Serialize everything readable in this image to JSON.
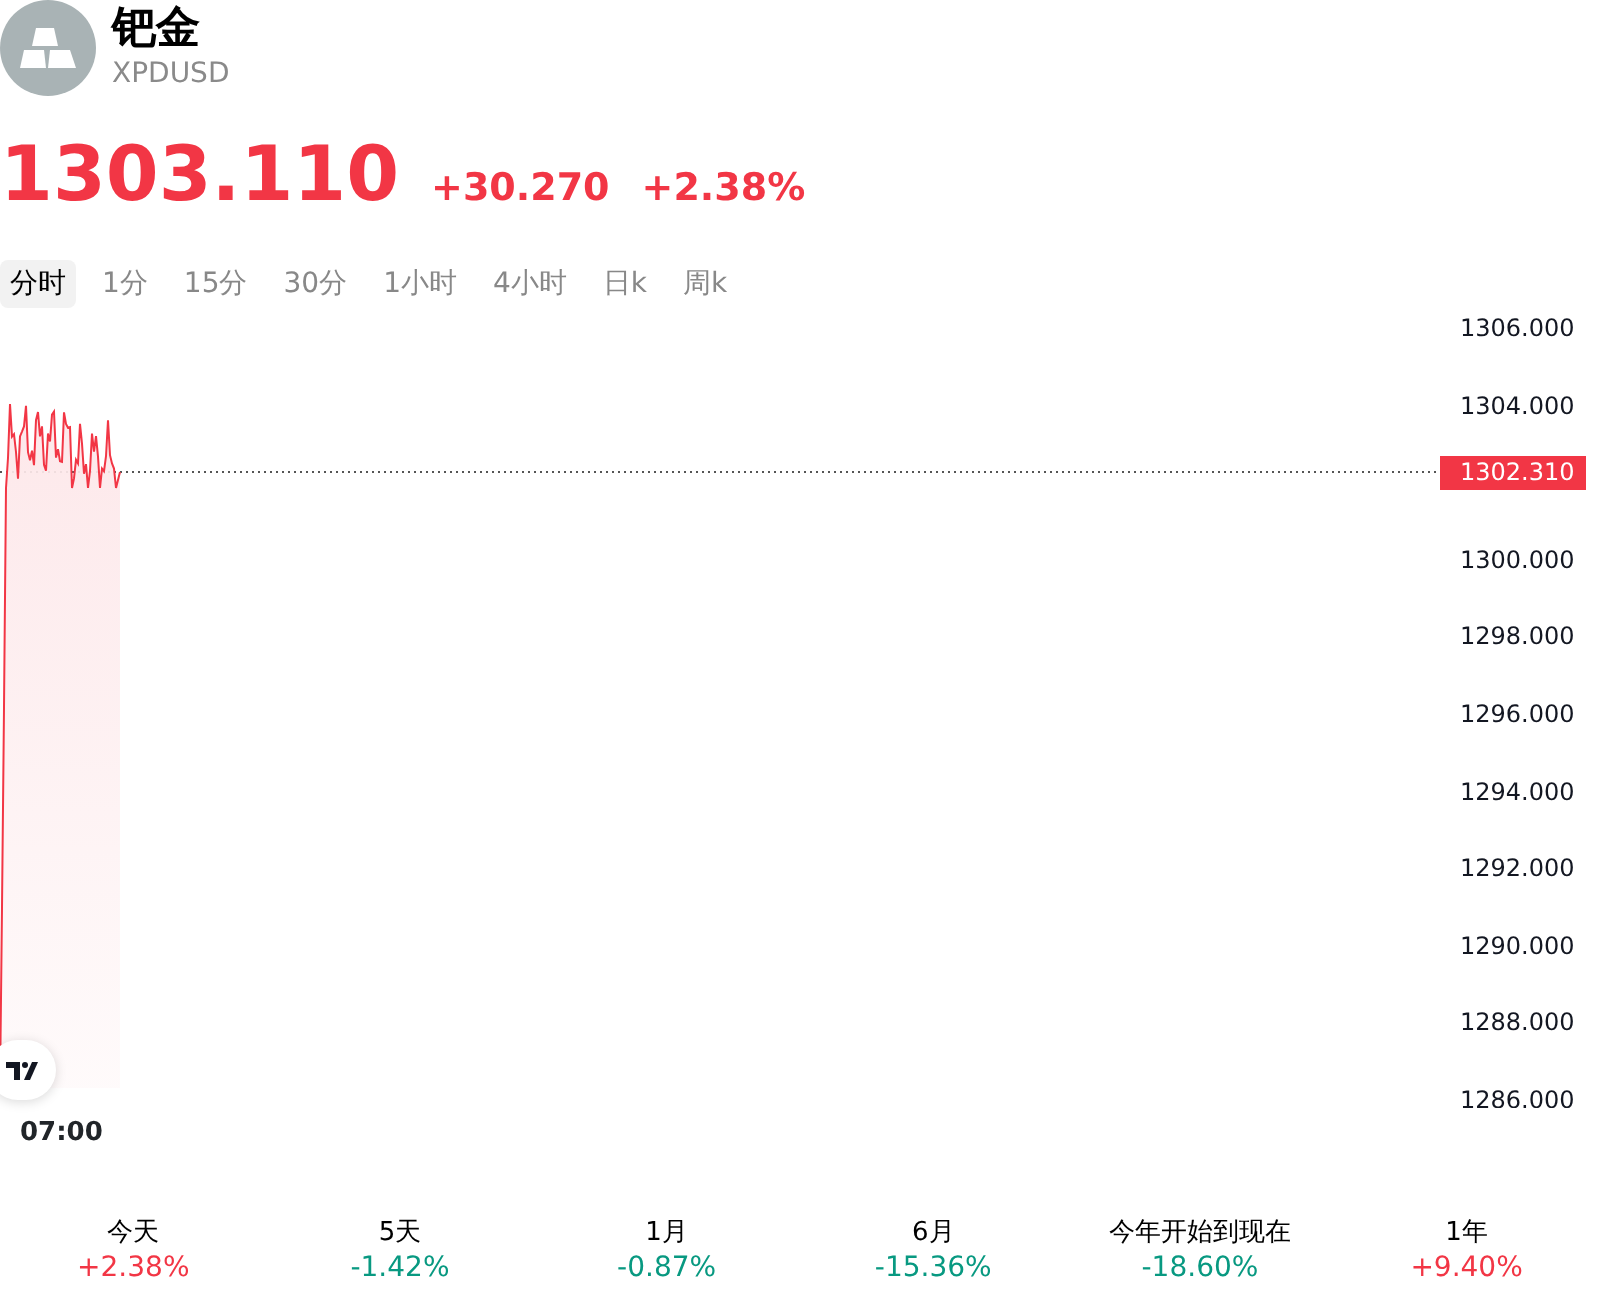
{
  "instrument": {
    "name": "钯金",
    "symbol": "XPDUSD"
  },
  "quote": {
    "price": "1303.110",
    "change": "+30.270",
    "change_percent": "+2.38%"
  },
  "intervals": [
    {
      "label": "分时",
      "selected": true
    },
    {
      "label": "1分",
      "selected": false
    },
    {
      "label": "15分",
      "selected": false
    },
    {
      "label": "30分",
      "selected": false
    },
    {
      "label": "1小时",
      "selected": false
    },
    {
      "label": "4小时",
      "selected": false
    },
    {
      "label": "日k",
      "selected": false
    },
    {
      "label": "周k",
      "selected": false
    }
  ],
  "chart": {
    "price_axis": [
      "1306.000",
      "1304.000",
      "1300.000",
      "1298.000",
      "1296.000",
      "1294.000",
      "1292.000",
      "1290.000",
      "1288.000",
      "1286.000"
    ],
    "current_price": "1302.310",
    "time_label": "07:00"
  },
  "periods": [
    {
      "label": "今天",
      "change": "+2.38%",
      "color": "#f23645"
    },
    {
      "label": "5天",
      "change": "-1.42%",
      "color": "#089981"
    },
    {
      "label": "1月",
      "change": "-0.87%",
      "color": "#089981"
    },
    {
      "label": "6月",
      "change": "-15.36%",
      "color": "#089981"
    },
    {
      "label": "今年开始到现在",
      "change": "-18.60%",
      "color": "#089981"
    },
    {
      "label": "1年",
      "change": "+9.40%",
      "color": "#f23645"
    }
  ]
}
